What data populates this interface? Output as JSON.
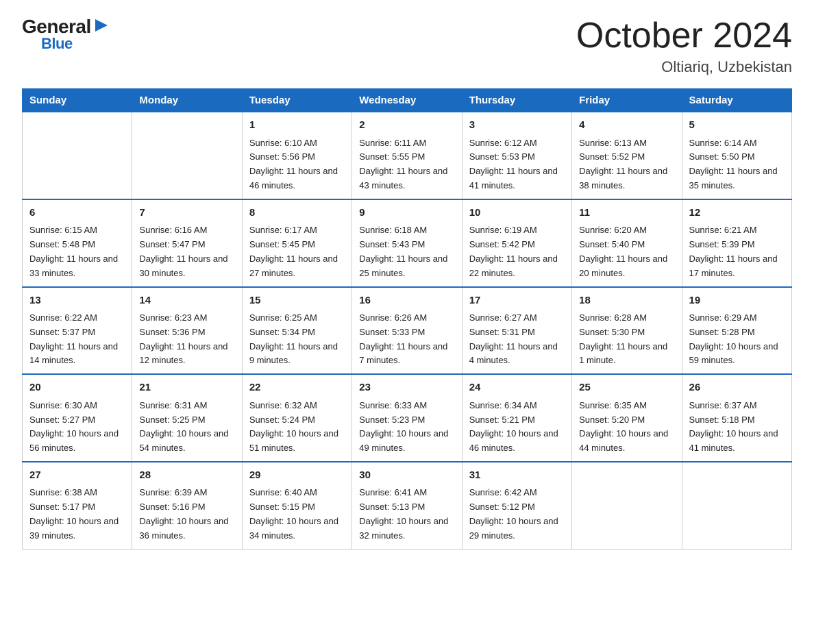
{
  "header": {
    "logo": {
      "general": "General",
      "blue": "Blue"
    },
    "title": "October 2024",
    "subtitle": "Oltiariq, Uzbekistan"
  },
  "days_of_week": [
    "Sunday",
    "Monday",
    "Tuesday",
    "Wednesday",
    "Thursday",
    "Friday",
    "Saturday"
  ],
  "weeks": [
    [
      {
        "day": "",
        "sunrise": "",
        "sunset": "",
        "daylight": ""
      },
      {
        "day": "",
        "sunrise": "",
        "sunset": "",
        "daylight": ""
      },
      {
        "day": "1",
        "sunrise": "Sunrise: 6:10 AM",
        "sunset": "Sunset: 5:56 PM",
        "daylight": "Daylight: 11 hours and 46 minutes."
      },
      {
        "day": "2",
        "sunrise": "Sunrise: 6:11 AM",
        "sunset": "Sunset: 5:55 PM",
        "daylight": "Daylight: 11 hours and 43 minutes."
      },
      {
        "day": "3",
        "sunrise": "Sunrise: 6:12 AM",
        "sunset": "Sunset: 5:53 PM",
        "daylight": "Daylight: 11 hours and 41 minutes."
      },
      {
        "day": "4",
        "sunrise": "Sunrise: 6:13 AM",
        "sunset": "Sunset: 5:52 PM",
        "daylight": "Daylight: 11 hours and 38 minutes."
      },
      {
        "day": "5",
        "sunrise": "Sunrise: 6:14 AM",
        "sunset": "Sunset: 5:50 PM",
        "daylight": "Daylight: 11 hours and 35 minutes."
      }
    ],
    [
      {
        "day": "6",
        "sunrise": "Sunrise: 6:15 AM",
        "sunset": "Sunset: 5:48 PM",
        "daylight": "Daylight: 11 hours and 33 minutes."
      },
      {
        "day": "7",
        "sunrise": "Sunrise: 6:16 AM",
        "sunset": "Sunset: 5:47 PM",
        "daylight": "Daylight: 11 hours and 30 minutes."
      },
      {
        "day": "8",
        "sunrise": "Sunrise: 6:17 AM",
        "sunset": "Sunset: 5:45 PM",
        "daylight": "Daylight: 11 hours and 27 minutes."
      },
      {
        "day": "9",
        "sunrise": "Sunrise: 6:18 AM",
        "sunset": "Sunset: 5:43 PM",
        "daylight": "Daylight: 11 hours and 25 minutes."
      },
      {
        "day": "10",
        "sunrise": "Sunrise: 6:19 AM",
        "sunset": "Sunset: 5:42 PM",
        "daylight": "Daylight: 11 hours and 22 minutes."
      },
      {
        "day": "11",
        "sunrise": "Sunrise: 6:20 AM",
        "sunset": "Sunset: 5:40 PM",
        "daylight": "Daylight: 11 hours and 20 minutes."
      },
      {
        "day": "12",
        "sunrise": "Sunrise: 6:21 AM",
        "sunset": "Sunset: 5:39 PM",
        "daylight": "Daylight: 11 hours and 17 minutes."
      }
    ],
    [
      {
        "day": "13",
        "sunrise": "Sunrise: 6:22 AM",
        "sunset": "Sunset: 5:37 PM",
        "daylight": "Daylight: 11 hours and 14 minutes."
      },
      {
        "day": "14",
        "sunrise": "Sunrise: 6:23 AM",
        "sunset": "Sunset: 5:36 PM",
        "daylight": "Daylight: 11 hours and 12 minutes."
      },
      {
        "day": "15",
        "sunrise": "Sunrise: 6:25 AM",
        "sunset": "Sunset: 5:34 PM",
        "daylight": "Daylight: 11 hours and 9 minutes."
      },
      {
        "day": "16",
        "sunrise": "Sunrise: 6:26 AM",
        "sunset": "Sunset: 5:33 PM",
        "daylight": "Daylight: 11 hours and 7 minutes."
      },
      {
        "day": "17",
        "sunrise": "Sunrise: 6:27 AM",
        "sunset": "Sunset: 5:31 PM",
        "daylight": "Daylight: 11 hours and 4 minutes."
      },
      {
        "day": "18",
        "sunrise": "Sunrise: 6:28 AM",
        "sunset": "Sunset: 5:30 PM",
        "daylight": "Daylight: 11 hours and 1 minute."
      },
      {
        "day": "19",
        "sunrise": "Sunrise: 6:29 AM",
        "sunset": "Sunset: 5:28 PM",
        "daylight": "Daylight: 10 hours and 59 minutes."
      }
    ],
    [
      {
        "day": "20",
        "sunrise": "Sunrise: 6:30 AM",
        "sunset": "Sunset: 5:27 PM",
        "daylight": "Daylight: 10 hours and 56 minutes."
      },
      {
        "day": "21",
        "sunrise": "Sunrise: 6:31 AM",
        "sunset": "Sunset: 5:25 PM",
        "daylight": "Daylight: 10 hours and 54 minutes."
      },
      {
        "day": "22",
        "sunrise": "Sunrise: 6:32 AM",
        "sunset": "Sunset: 5:24 PM",
        "daylight": "Daylight: 10 hours and 51 minutes."
      },
      {
        "day": "23",
        "sunrise": "Sunrise: 6:33 AM",
        "sunset": "Sunset: 5:23 PM",
        "daylight": "Daylight: 10 hours and 49 minutes."
      },
      {
        "day": "24",
        "sunrise": "Sunrise: 6:34 AM",
        "sunset": "Sunset: 5:21 PM",
        "daylight": "Daylight: 10 hours and 46 minutes."
      },
      {
        "day": "25",
        "sunrise": "Sunrise: 6:35 AM",
        "sunset": "Sunset: 5:20 PM",
        "daylight": "Daylight: 10 hours and 44 minutes."
      },
      {
        "day": "26",
        "sunrise": "Sunrise: 6:37 AM",
        "sunset": "Sunset: 5:18 PM",
        "daylight": "Daylight: 10 hours and 41 minutes."
      }
    ],
    [
      {
        "day": "27",
        "sunrise": "Sunrise: 6:38 AM",
        "sunset": "Sunset: 5:17 PM",
        "daylight": "Daylight: 10 hours and 39 minutes."
      },
      {
        "day": "28",
        "sunrise": "Sunrise: 6:39 AM",
        "sunset": "Sunset: 5:16 PM",
        "daylight": "Daylight: 10 hours and 36 minutes."
      },
      {
        "day": "29",
        "sunrise": "Sunrise: 6:40 AM",
        "sunset": "Sunset: 5:15 PM",
        "daylight": "Daylight: 10 hours and 34 minutes."
      },
      {
        "day": "30",
        "sunrise": "Sunrise: 6:41 AM",
        "sunset": "Sunset: 5:13 PM",
        "daylight": "Daylight: 10 hours and 32 minutes."
      },
      {
        "day": "31",
        "sunrise": "Sunrise: 6:42 AM",
        "sunset": "Sunset: 5:12 PM",
        "daylight": "Daylight: 10 hours and 29 minutes."
      },
      {
        "day": "",
        "sunrise": "",
        "sunset": "",
        "daylight": ""
      },
      {
        "day": "",
        "sunrise": "",
        "sunset": "",
        "daylight": ""
      }
    ]
  ]
}
